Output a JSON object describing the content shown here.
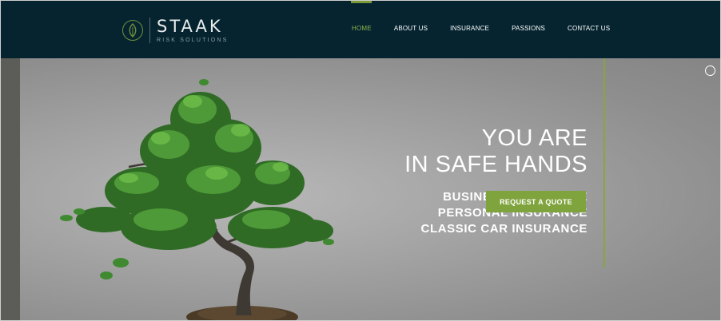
{
  "brand": {
    "name": "STAAK",
    "tagline": "RISK SOLUTIONS",
    "accent": "#7fa43d",
    "header_bg": "#062430"
  },
  "nav": {
    "items": [
      {
        "label": "HOME",
        "active": true
      },
      {
        "label": "ABOUT US",
        "active": false
      },
      {
        "label": "INSURANCE",
        "active": false
      },
      {
        "label": "PASSIONS",
        "active": false
      },
      {
        "label": "CONTACT US",
        "active": false
      }
    ]
  },
  "hero": {
    "title_line1": "YOU ARE",
    "title_line2": "IN SAFE HANDS",
    "services": [
      "BUSINESS INSURANCE",
      "PERSONAL INSURANCE",
      "CLASSIC CAR INSURANCE"
    ],
    "cta_label": "REQUEST A QUOTE",
    "image": "bonsai-tree",
    "slider_indicator": "circle-icon"
  }
}
